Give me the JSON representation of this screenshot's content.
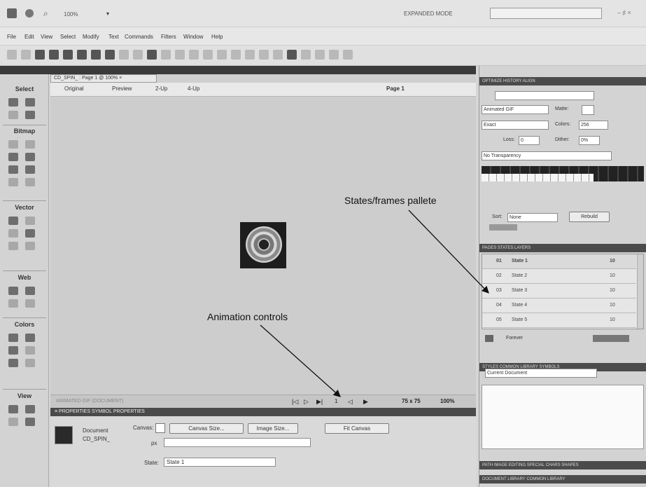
{
  "app": {
    "zoom": "100%",
    "mode_menu": "EXPANDED MODE",
    "window_controls": "– ♯ ×"
  },
  "menu": [
    "File",
    "Edit",
    "View",
    "Select",
    "Modify",
    "Text",
    "Commands",
    "Filters",
    "Window",
    "Help"
  ],
  "document": {
    "tab_title": "CD_SPIN_ : Page 1 @ 100% ×",
    "view_tabs": [
      "Original",
      "Preview",
      "2-Up",
      "4-Up"
    ],
    "page_menu": "Page 1",
    "status_left": "ANIMATED GIF (DOCUMENT)",
    "animation_frame": "1",
    "canvas_size": "75 x 75",
    "zoom": "100%"
  },
  "tools": {
    "sections": [
      "Select",
      "Bitmap",
      "Vector",
      "Web",
      "Colors",
      "View"
    ]
  },
  "properties": {
    "tabs": "≡ PROPERTIES    SYMBOL PROPERTIES",
    "doc_type": "Document",
    "doc_name": "CD_SPIN_",
    "canvas_label": "Canvas:",
    "canvas_size_button": "Canvas Size...",
    "image_size_button": "Image Size...",
    "fit_canvas_button": "Fit Canvas",
    "state_label": "State:",
    "state_value": "State 1"
  },
  "optimize": {
    "tabs": "OPTIMIZE   HISTORY   ALIGN",
    "format": "Animated GIF",
    "matte_label": "Matte:",
    "palette": "Exact",
    "colors_label": "Colors:",
    "colors_value": "256",
    "loss_label": "Loss:",
    "loss_value": "0",
    "dither_label": "Dither:",
    "dither_value": "0%",
    "transparency": "No Transparency",
    "sort_label": "Sort:",
    "sort_value": "None",
    "rebuild_button": "Rebuild"
  },
  "states_panel": {
    "tabs": "PAGES   STATES   LAYERS",
    "rows": [
      {
        "num": "01",
        "name": "State 1",
        "delay": "10"
      },
      {
        "num": "02",
        "name": "State 2",
        "delay": "10"
      },
      {
        "num": "03",
        "name": "State 3",
        "delay": "10"
      },
      {
        "num": "04",
        "name": "State 4",
        "delay": "10"
      },
      {
        "num": "05",
        "name": "State 5",
        "delay": "10"
      }
    ],
    "loop_label": "Forever"
  },
  "styles_panel": {
    "tabs": "STYLES   COMMON LIBRARY   SYMBOLS",
    "source": "Current Document"
  },
  "bottom_tabs": {
    "row1": "PATH   IMAGE EDITING   SPECIAL CHARS SHAPES",
    "row2": "DOCUMENT LIBRARY   COMMON LIBRARY"
  },
  "annotations": {
    "states": "States/frames pallete",
    "animation": "Animation controls"
  }
}
